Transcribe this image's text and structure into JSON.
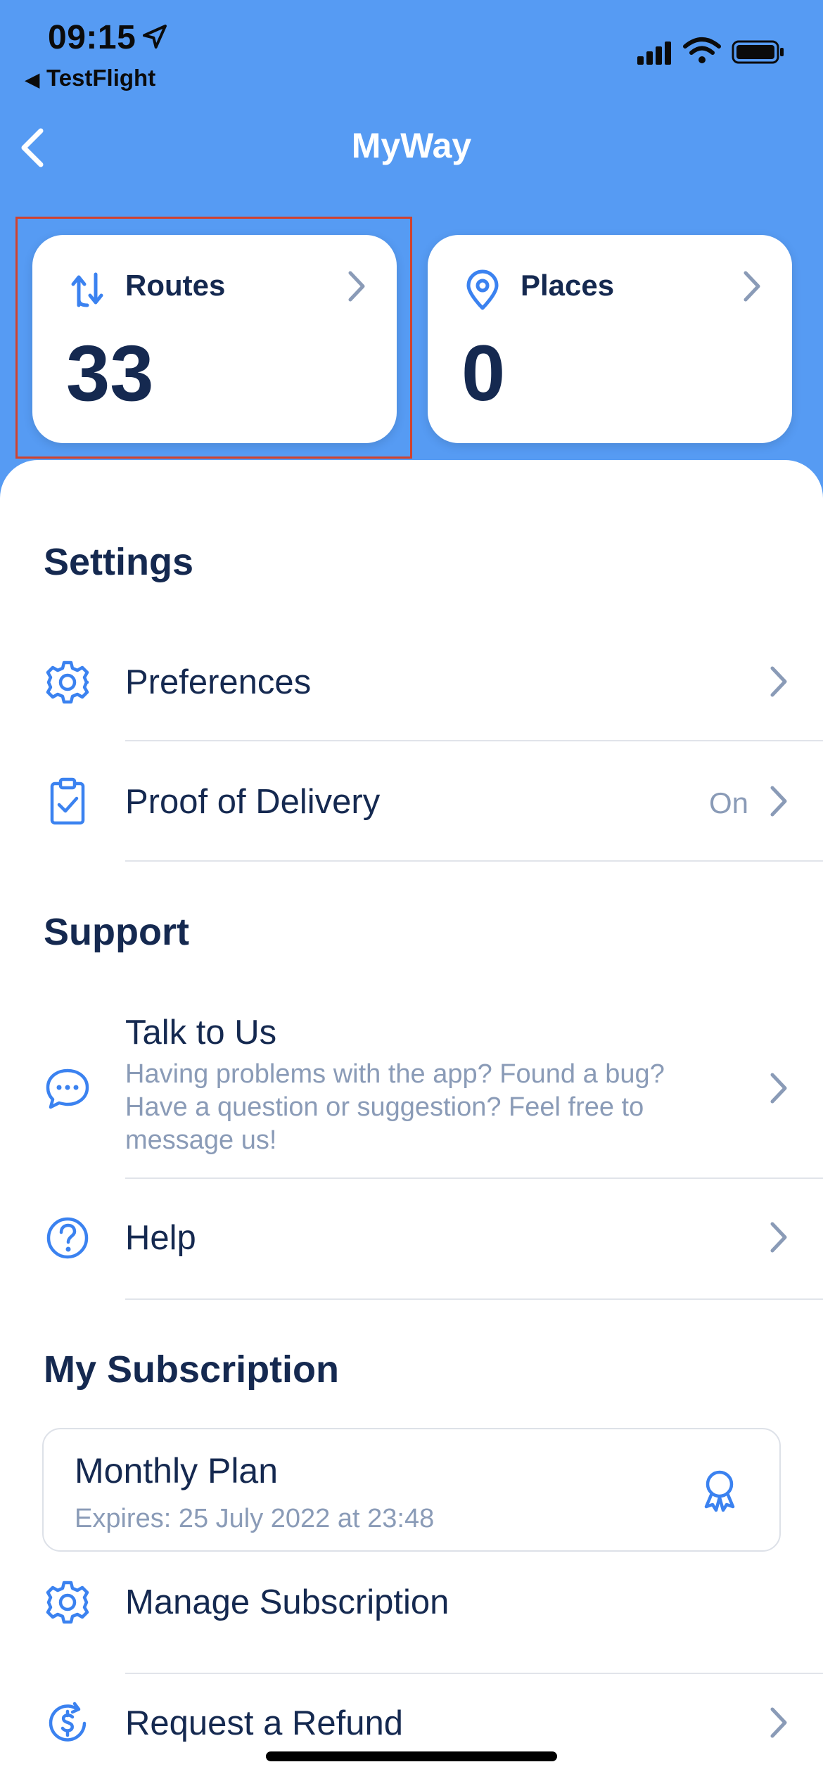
{
  "status_bar": {
    "time": "09:15",
    "back_app": "TestFlight"
  },
  "nav": {
    "title": "MyWay"
  },
  "cards": [
    {
      "label": "Routes",
      "value": "33",
      "icon": "routes-icon"
    },
    {
      "label": "Places",
      "value": "0",
      "icon": "location-pin-icon"
    }
  ],
  "settings": {
    "heading": "Settings",
    "items": [
      {
        "label": "Preferences",
        "icon": "gear-icon"
      },
      {
        "label": "Proof of Delivery",
        "value": "On",
        "icon": "clipboard-check-icon"
      }
    ]
  },
  "support": {
    "heading": "Support",
    "talk": {
      "label": "Talk to Us",
      "description": "Having problems with the app? Found a bug? Have a question or suggestion? Feel free to message us!",
      "icon": "chat-bubble-icon"
    },
    "help": {
      "label": "Help",
      "icon": "question-circle-icon"
    }
  },
  "subscription": {
    "heading": "My Subscription",
    "plan": {
      "title": "Monthly Plan",
      "expires": "Expires: 25 July 2022 at 23:48",
      "icon": "award-ribbon-icon"
    },
    "manage": {
      "label": "Manage Subscription",
      "icon": "gear-icon"
    },
    "refund": {
      "label": "Request a Refund",
      "icon": "dollar-refresh-icon"
    }
  },
  "colors": {
    "accent": "#569bf3",
    "icon_blue": "#3b82f0",
    "text_dark": "#152950",
    "text_muted": "#8a9bb7",
    "highlight": "#d0422e"
  }
}
